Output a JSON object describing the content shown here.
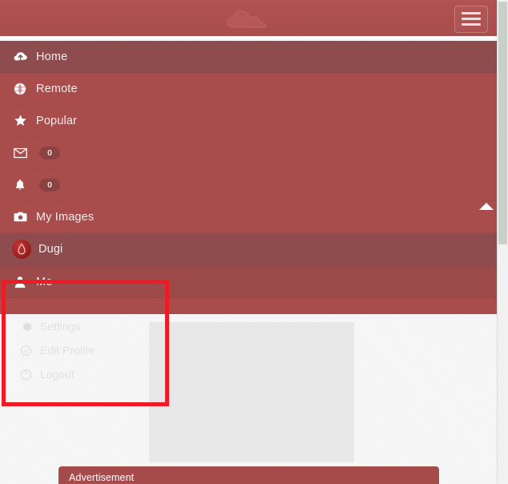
{
  "navbar": {
    "logo_name": "cloud-logo",
    "menu_toggle_label": "Toggle navigation"
  },
  "menu": {
    "items": [
      {
        "label": "Home",
        "icon": "cloud-upload-icon",
        "active": true,
        "badge": null
      },
      {
        "label": "Remote",
        "icon": "globe-icon",
        "active": false,
        "badge": null
      },
      {
        "label": "Popular",
        "icon": "star-icon",
        "active": false,
        "badge": null
      },
      {
        "label": "",
        "icon": "envelope-icon",
        "active": false,
        "badge": "0"
      },
      {
        "label": "",
        "icon": "bell-icon",
        "active": false,
        "badge": "0"
      },
      {
        "label": "My Images",
        "icon": "camera-icon",
        "active": false,
        "badge": null
      }
    ],
    "account": {
      "label": "Dugi",
      "icon": "user-avatar"
    },
    "me": {
      "label": "Me",
      "icon": "person-icon"
    }
  },
  "submenu": {
    "items": [
      {
        "label": "Settings",
        "icon": "gear-icon"
      },
      {
        "label": "Edit Profile",
        "icon": "edit-profile-icon"
      },
      {
        "label": "Logout",
        "icon": "logout-icon"
      }
    ]
  },
  "advertisement": {
    "label": "Advertisement"
  },
  "colors": {
    "navbar_bg": "#a84c4c",
    "menu_bg": "#a94c4c",
    "menu_active_bg": "#8f4c4f",
    "annotation": "#ee1b24",
    "ad_bg": "#a64b4b",
    "content_placeholder": "#e8e8e8"
  }
}
